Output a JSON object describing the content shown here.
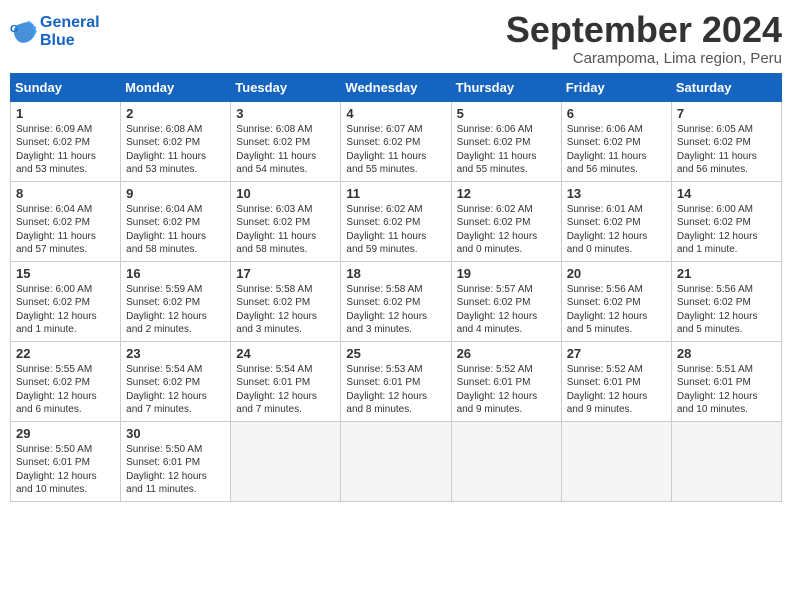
{
  "logo": {
    "line1": "General",
    "line2": "Blue"
  },
  "title": "September 2024",
  "location": "Carampoma, Lima region, Peru",
  "days_of_week": [
    "Sunday",
    "Monday",
    "Tuesday",
    "Wednesday",
    "Thursday",
    "Friday",
    "Saturday"
  ],
  "weeks": [
    [
      {
        "day": "1",
        "detail": "Sunrise: 6:09 AM\nSunset: 6:02 PM\nDaylight: 11 hours\nand 53 minutes."
      },
      {
        "day": "2",
        "detail": "Sunrise: 6:08 AM\nSunset: 6:02 PM\nDaylight: 11 hours\nand 53 minutes."
      },
      {
        "day": "3",
        "detail": "Sunrise: 6:08 AM\nSunset: 6:02 PM\nDaylight: 11 hours\nand 54 minutes."
      },
      {
        "day": "4",
        "detail": "Sunrise: 6:07 AM\nSunset: 6:02 PM\nDaylight: 11 hours\nand 55 minutes."
      },
      {
        "day": "5",
        "detail": "Sunrise: 6:06 AM\nSunset: 6:02 PM\nDaylight: 11 hours\nand 55 minutes."
      },
      {
        "day": "6",
        "detail": "Sunrise: 6:06 AM\nSunset: 6:02 PM\nDaylight: 11 hours\nand 56 minutes."
      },
      {
        "day": "7",
        "detail": "Sunrise: 6:05 AM\nSunset: 6:02 PM\nDaylight: 11 hours\nand 56 minutes."
      }
    ],
    [
      {
        "day": "8",
        "detail": "Sunrise: 6:04 AM\nSunset: 6:02 PM\nDaylight: 11 hours\nand 57 minutes."
      },
      {
        "day": "9",
        "detail": "Sunrise: 6:04 AM\nSunset: 6:02 PM\nDaylight: 11 hours\nand 58 minutes."
      },
      {
        "day": "10",
        "detail": "Sunrise: 6:03 AM\nSunset: 6:02 PM\nDaylight: 11 hours\nand 58 minutes."
      },
      {
        "day": "11",
        "detail": "Sunrise: 6:02 AM\nSunset: 6:02 PM\nDaylight: 11 hours\nand 59 minutes."
      },
      {
        "day": "12",
        "detail": "Sunrise: 6:02 AM\nSunset: 6:02 PM\nDaylight: 12 hours\nand 0 minutes."
      },
      {
        "day": "13",
        "detail": "Sunrise: 6:01 AM\nSunset: 6:02 PM\nDaylight: 12 hours\nand 0 minutes."
      },
      {
        "day": "14",
        "detail": "Sunrise: 6:00 AM\nSunset: 6:02 PM\nDaylight: 12 hours\nand 1 minute."
      }
    ],
    [
      {
        "day": "15",
        "detail": "Sunrise: 6:00 AM\nSunset: 6:02 PM\nDaylight: 12 hours\nand 1 minute."
      },
      {
        "day": "16",
        "detail": "Sunrise: 5:59 AM\nSunset: 6:02 PM\nDaylight: 12 hours\nand 2 minutes."
      },
      {
        "day": "17",
        "detail": "Sunrise: 5:58 AM\nSunset: 6:02 PM\nDaylight: 12 hours\nand 3 minutes."
      },
      {
        "day": "18",
        "detail": "Sunrise: 5:58 AM\nSunset: 6:02 PM\nDaylight: 12 hours\nand 3 minutes."
      },
      {
        "day": "19",
        "detail": "Sunrise: 5:57 AM\nSunset: 6:02 PM\nDaylight: 12 hours\nand 4 minutes."
      },
      {
        "day": "20",
        "detail": "Sunrise: 5:56 AM\nSunset: 6:02 PM\nDaylight: 12 hours\nand 5 minutes."
      },
      {
        "day": "21",
        "detail": "Sunrise: 5:56 AM\nSunset: 6:02 PM\nDaylight: 12 hours\nand 5 minutes."
      }
    ],
    [
      {
        "day": "22",
        "detail": "Sunrise: 5:55 AM\nSunset: 6:02 PM\nDaylight: 12 hours\nand 6 minutes."
      },
      {
        "day": "23",
        "detail": "Sunrise: 5:54 AM\nSunset: 6:02 PM\nDaylight: 12 hours\nand 7 minutes."
      },
      {
        "day": "24",
        "detail": "Sunrise: 5:54 AM\nSunset: 6:01 PM\nDaylight: 12 hours\nand 7 minutes."
      },
      {
        "day": "25",
        "detail": "Sunrise: 5:53 AM\nSunset: 6:01 PM\nDaylight: 12 hours\nand 8 minutes."
      },
      {
        "day": "26",
        "detail": "Sunrise: 5:52 AM\nSunset: 6:01 PM\nDaylight: 12 hours\nand 9 minutes."
      },
      {
        "day": "27",
        "detail": "Sunrise: 5:52 AM\nSunset: 6:01 PM\nDaylight: 12 hours\nand 9 minutes."
      },
      {
        "day": "28",
        "detail": "Sunrise: 5:51 AM\nSunset: 6:01 PM\nDaylight: 12 hours\nand 10 minutes."
      }
    ],
    [
      {
        "day": "29",
        "detail": "Sunrise: 5:50 AM\nSunset: 6:01 PM\nDaylight: 12 hours\nand 10 minutes."
      },
      {
        "day": "30",
        "detail": "Sunrise: 5:50 AM\nSunset: 6:01 PM\nDaylight: 12 hours\nand 11 minutes."
      },
      {
        "day": "",
        "detail": ""
      },
      {
        "day": "",
        "detail": ""
      },
      {
        "day": "",
        "detail": ""
      },
      {
        "day": "",
        "detail": ""
      },
      {
        "day": "",
        "detail": ""
      }
    ]
  ]
}
